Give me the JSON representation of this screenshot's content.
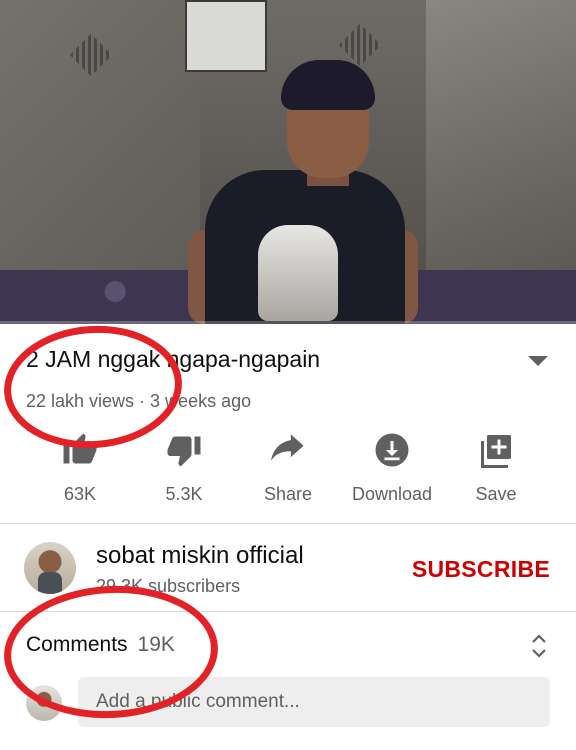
{
  "video": {
    "progress_fraction": 0.0
  },
  "title": "2 JAM nggak ngapa-ngapain",
  "meta": "22 lakh views · 3 weeks ago",
  "actions": [
    {
      "name": "like",
      "icon": "thumb-up-icon",
      "label": "63K"
    },
    {
      "name": "dislike",
      "icon": "thumb-down-icon",
      "label": "5.3K"
    },
    {
      "name": "share",
      "icon": "share-arrow-icon",
      "label": "Share"
    },
    {
      "name": "download",
      "icon": "download-icon",
      "label": "Download"
    },
    {
      "name": "save",
      "icon": "playlist-add-icon",
      "label": "Save"
    }
  ],
  "channel": {
    "name": "sobat miskin official",
    "subscribers": "29.3K subscribers",
    "subscribe_label": "SUBSCRIBE"
  },
  "comments": {
    "label": "Comments",
    "count": "19K",
    "placeholder": "Add a public comment..."
  },
  "colors": {
    "subscribe": "#cc0000",
    "annotation": "#e32228",
    "secondary_text": "#606060"
  }
}
